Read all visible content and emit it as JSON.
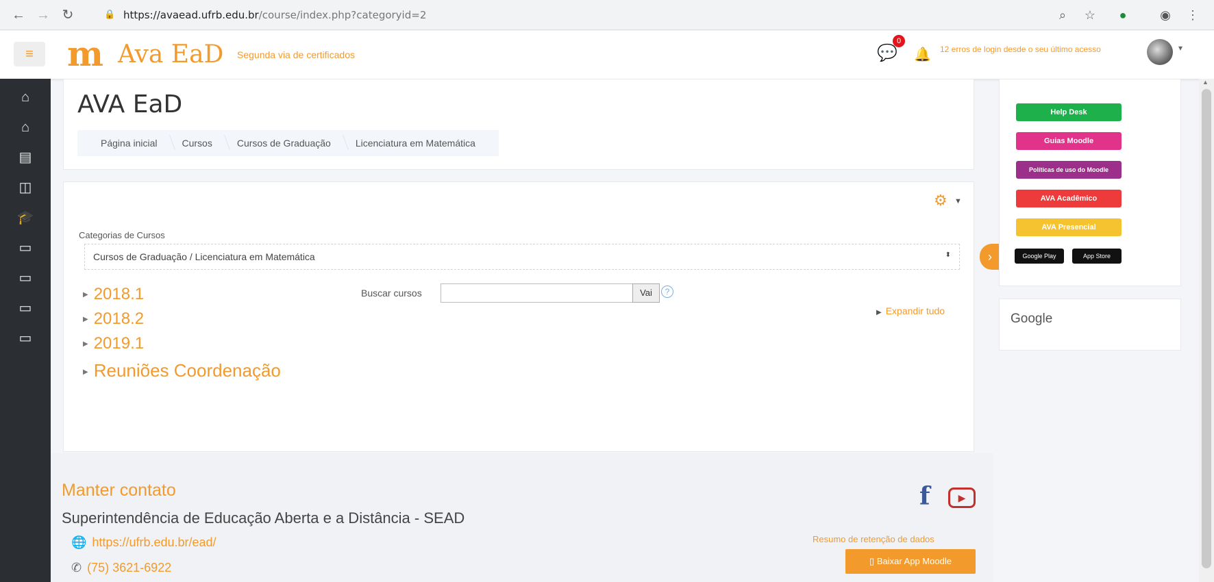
{
  "browser": {
    "url_host": "https://avaead.ufrb.edu.br",
    "url_path": "/course/index.php?categoryid=2"
  },
  "navbar": {
    "logo_letter": "m",
    "logo_text": "Ava EaD",
    "tagline": "Segunda via de certificados",
    "chat_count": "0",
    "login_message": "12 erros de login desde o seu último acesso"
  },
  "header": {
    "title": "AVA EaD",
    "breadcrumb": [
      "Página inicial",
      "Cursos",
      "Cursos de Graduação",
      "Licenciatura em Matemática"
    ]
  },
  "main": {
    "category_label": "Categorias de Cursos",
    "category_selected": "Cursos de Graduação / Licenciatura em Matemática",
    "search_label": "Buscar cursos",
    "search_value": "",
    "go_button": "Vai",
    "expand_all": "Expandir tudo",
    "categories": [
      "2018.1",
      "2018.2",
      "2019.1",
      "Reuniões Coordenação"
    ]
  },
  "right": {
    "buttons": [
      {
        "label": "Help Desk",
        "color": "#1eb04a"
      },
      {
        "label": "Guias Moodle",
        "color": "#e2338a"
      },
      {
        "label": "Políticas de uso do Moodle",
        "color": "#9b2f8a"
      },
      {
        "label": "AVA Acadêmico",
        "color": "#ed3b3b"
      },
      {
        "label": "AVA Presencial",
        "color": "#f6c330"
      }
    ],
    "store_google": "Google Play",
    "store_apple": "App Store",
    "google_title": "Google"
  },
  "footer": {
    "contact_title": "Manter contato",
    "org_name": "Superintendência de Educação Aberta e a Distância - SEAD",
    "site_link": "https://ufrb.edu.br/ead/",
    "phone": "(75) 3621-6922",
    "data_retention": "Resumo de retenção de dados",
    "app_button": "Baixar App Moodle"
  },
  "colors": {
    "accent": "#f39a2d",
    "drawer": "#2b2f33"
  },
  "icons": [
    "back-icon",
    "forward-icon",
    "reload-icon",
    "lock-icon",
    "zoom-icon",
    "star-icon",
    "extension-icon",
    "profile-icon",
    "menu-dots-icon",
    "hamburger-icon",
    "chat-icon",
    "bell-icon",
    "home-icon",
    "dashboard-icon",
    "calendar-icon",
    "files-icon",
    "graduation-icon",
    "folder-icon",
    "gear-icon",
    "help-icon",
    "globe-icon",
    "phone-icon",
    "facebook-icon",
    "youtube-icon",
    "mobile-icon"
  ]
}
